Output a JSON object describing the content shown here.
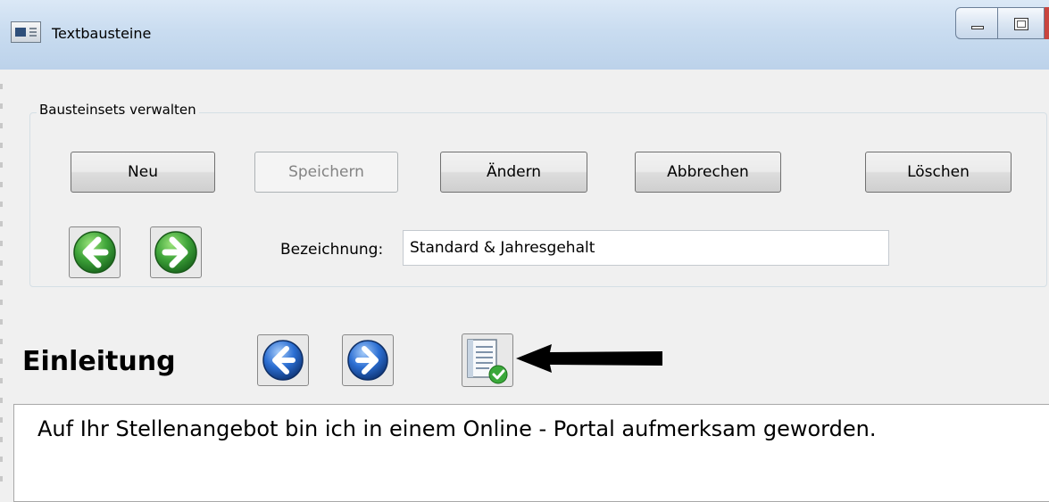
{
  "window": {
    "title": "Textbausteine",
    "icon": "app-window-icon",
    "controls": [
      "minimize-icon",
      "maximize-icon"
    ]
  },
  "group": {
    "legend": "Bausteinsets verwalten",
    "buttons": {
      "neu": "Neu",
      "speichern": "Speichern",
      "aendern": "Ändern",
      "abbrechen": "Abbrechen",
      "loeschen": "Löschen"
    },
    "nav_icons": [
      "green-arrow-left-icon",
      "green-arrow-right-icon"
    ],
    "bezeichnung_label": "Bezeichnung:",
    "bezeichnung_value": "Standard & Jahresgehalt"
  },
  "section": {
    "title": "Einleitung",
    "nav_icons": [
      "blue-arrow-left-icon",
      "blue-arrow-right-icon"
    ],
    "action_icon": "document-check-icon",
    "annotation_icon": "black-arrow-pointer-icon",
    "text": "Auf Ihr Stellenangebot bin ich in einem Online - Portal aufmerksam geworden."
  },
  "colors": {
    "green_button": "#3fa53a",
    "blue_button": "#2c6fd3",
    "titlebar": "#c9dcf0"
  }
}
